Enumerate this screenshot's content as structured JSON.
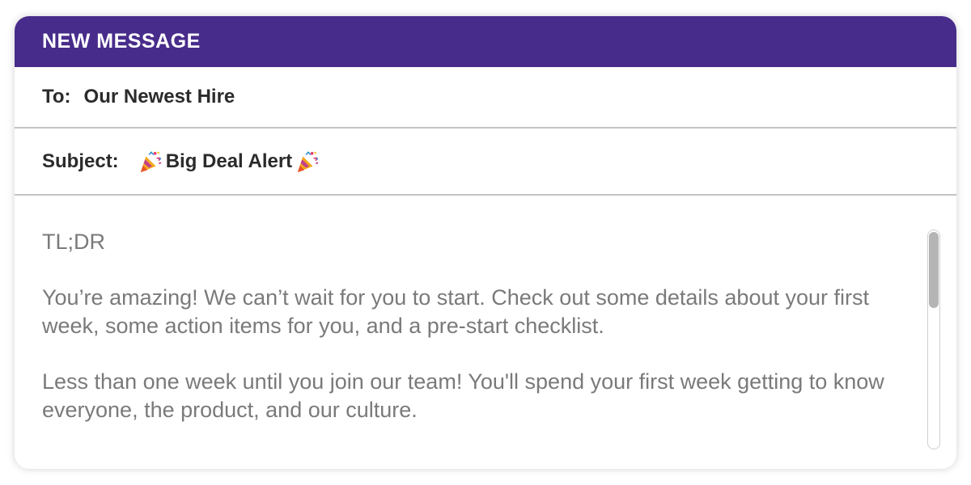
{
  "header": {
    "title": "NEW MESSAGE",
    "color": "#482c8b"
  },
  "to": {
    "label": "To:",
    "value": "Our Newest Hire"
  },
  "subject": {
    "label": "Subject:",
    "icon": "party-popper-icon",
    "text": "Big Deal Alert"
  },
  "body": {
    "paragraphs": [
      "TL;DR",
      "You’re amazing! We can’t wait for you to start. Check out some details about your first week, some action items for you, and a pre-start checklist.",
      "Less than one week until you join our team! You'll spend your first week getting to know everyone, the product, and our culture."
    ]
  },
  "scrollbar": {
    "position_fraction": 0.0
  }
}
